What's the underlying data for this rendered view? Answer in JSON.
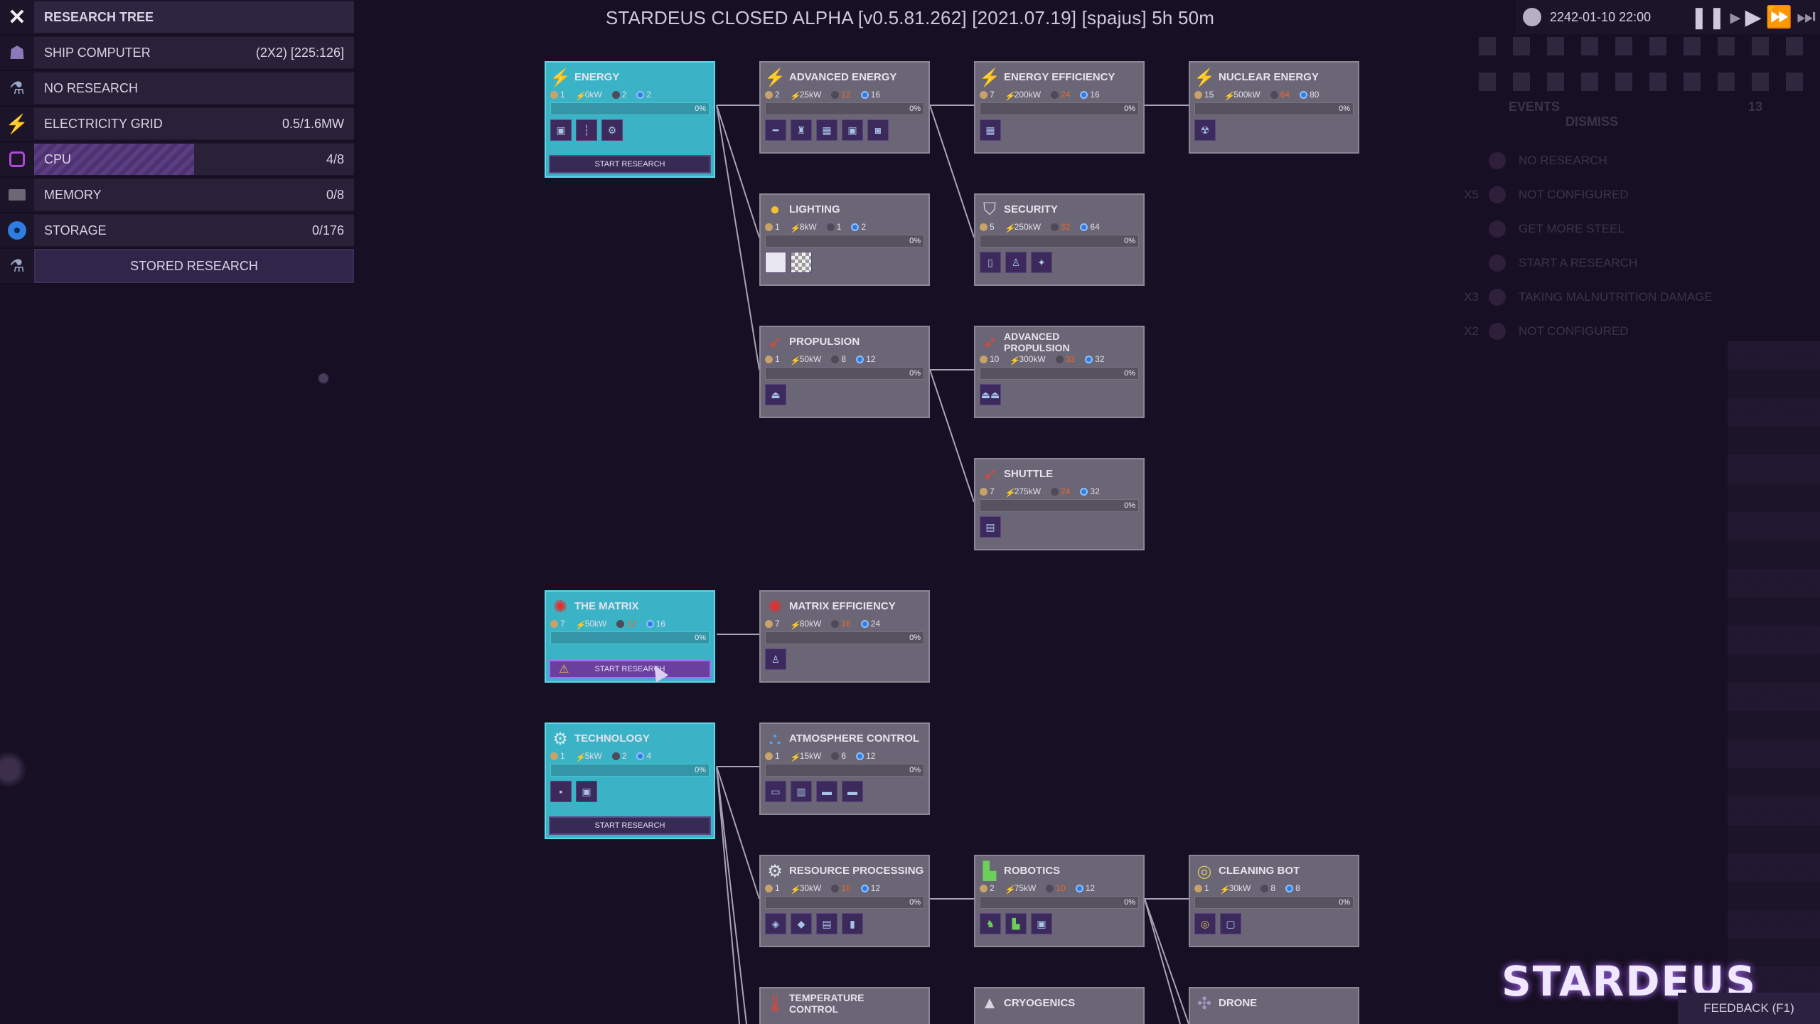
{
  "window_title": "STARDEUS CLOSED ALPHA [v0.5.81.262] [2021.07.19] [spajus] 5h 50m",
  "left_panel": {
    "title": "RESEARCH TREE",
    "rows": [
      {
        "label": "SHIP COMPUTER",
        "value": "(2X2) [225:126]",
        "icon": "ship-computer-icon"
      },
      {
        "label": "NO RESEARCH",
        "value": "",
        "icon": "no-research-icon"
      },
      {
        "label": "ELECTRICITY GRID",
        "value": "0.5/1.6MW",
        "icon": "lightning-icon"
      },
      {
        "label": "CPU",
        "value": "4/8",
        "icon": "cpu-icon",
        "fill": 0.5
      },
      {
        "label": "MEMORY",
        "value": "0/8",
        "icon": "memory-icon"
      },
      {
        "label": "STORAGE",
        "value": "0/176",
        "icon": "storage-icon"
      }
    ],
    "stored_button": "STORED RESEARCH"
  },
  "top_right": {
    "date": "2242-01-10 22:00"
  },
  "events": {
    "title": "EVENTS",
    "count": "13",
    "dismiss": "DISMISS",
    "rows": [
      {
        "count": "",
        "label": "NO RESEARCH"
      },
      {
        "count": "X5",
        "label": "NOT CONFIGURED"
      },
      {
        "count": "",
        "label": "GET MORE STEEL"
      },
      {
        "count": "",
        "label": "START A RESEARCH"
      },
      {
        "count": "X3",
        "label": "TAKING MALNUTRITION DAMAGE"
      },
      {
        "count": "X2",
        "label": "NOT CONFIGURED"
      }
    ]
  },
  "research_nodes": {
    "energy": {
      "name": "ENERGY",
      "time": "1",
      "power": "0kW",
      "cpu": "2",
      "data": "2",
      "progress": "0%",
      "button": "START RESEARCH"
    },
    "advanced_energy": {
      "name": "ADVANCED ENERGY",
      "time": "2",
      "power": "25kW",
      "cpu": "12",
      "data": "16",
      "progress": "0%"
    },
    "energy_efficiency": {
      "name": "ENERGY EFFICIENCY",
      "time": "7",
      "power": "200kW",
      "cpu": "24",
      "data": "16",
      "progress": "0%"
    },
    "nuclear_energy": {
      "name": "NUCLEAR ENERGY",
      "time": "15",
      "power": "500kW",
      "cpu": "64",
      "data": "80",
      "progress": "0%"
    },
    "lighting": {
      "name": "LIGHTING",
      "time": "1",
      "power": "8kW",
      "cpu": "1",
      "data": "2",
      "progress": "0%"
    },
    "security": {
      "name": "SECURITY",
      "time": "5",
      "power": "250kW",
      "cpu": "32",
      "data": "64",
      "progress": "0%"
    },
    "propulsion": {
      "name": "PROPULSION",
      "time": "1",
      "power": "50kW",
      "cpu": "8",
      "data": "12",
      "progress": "0%"
    },
    "advanced_propulsion": {
      "name": "ADVANCED PROPULSION",
      "time": "10",
      "power": "300kW",
      "cpu": "32",
      "data": "32",
      "progress": "0%"
    },
    "shuttle": {
      "name": "SHUTTLE",
      "time": "7",
      "power": "275kW",
      "cpu": "24",
      "data": "32",
      "progress": "0%"
    },
    "the_matrix": {
      "name": "THE MATRIX",
      "time": "7",
      "power": "50kW",
      "cpu": "12",
      "data": "16",
      "progress": "0%",
      "button": "START RESEARCH"
    },
    "matrix_efficiency": {
      "name": "MATRIX EFFICIENCY",
      "time": "7",
      "power": "80kW",
      "cpu": "16",
      "data": "24",
      "progress": "0%"
    },
    "technology": {
      "name": "TECHNOLOGY",
      "time": "1",
      "power": "5kW",
      "cpu": "2",
      "data": "4",
      "progress": "0%",
      "button": "START RESEARCH"
    },
    "atmosphere_control": {
      "name": "ATMOSPHERE CONTROL",
      "time": "1",
      "power": "15kW",
      "cpu": "6",
      "data": "12",
      "progress": "0%"
    },
    "resource_processing": {
      "name": "RESOURCE PROCESSING",
      "time": "1",
      "power": "30kW",
      "cpu": "10",
      "data": "12",
      "progress": "0%"
    },
    "robotics": {
      "name": "ROBOTICS",
      "time": "2",
      "power": "75kW",
      "cpu": "10",
      "data": "12",
      "progress": "0%"
    },
    "cleaning_bot": {
      "name": "CLEANING BOT",
      "time": "1",
      "power": "30kW",
      "cpu": "8",
      "data": "8",
      "progress": "0%"
    },
    "temperature_control": {
      "name": "TEMPERATURE CONTROL"
    },
    "cryogenics": {
      "name": "CRYOGENICS"
    },
    "drone": {
      "name": "DRONE"
    }
  },
  "logo": "STARDEUS",
  "feedback": "FEEDBACK (F1)"
}
